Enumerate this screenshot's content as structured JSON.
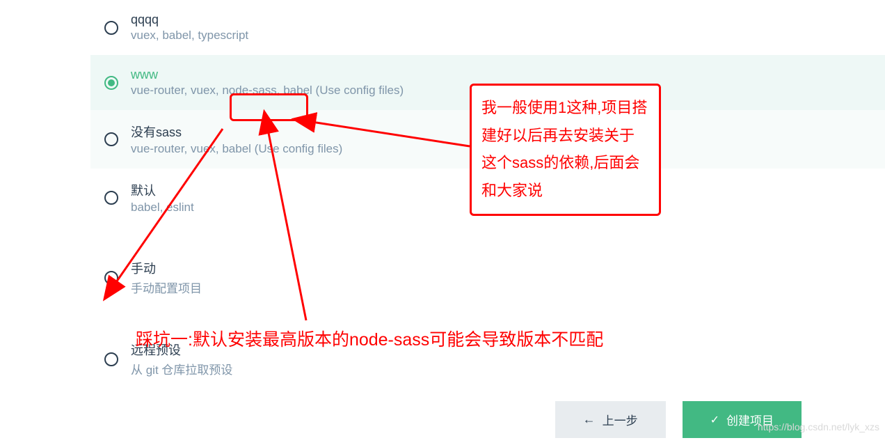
{
  "options": [
    {
      "title": "qqqq",
      "desc": "vuex, babel, typescript",
      "selected": false
    },
    {
      "title": "www",
      "desc": "vue-router, vuex, node-sass, babel (Use config files)",
      "selected": true
    },
    {
      "title": "没有sass",
      "desc": "vue-router, vuex, babel (Use config files)",
      "selected": false
    },
    {
      "title": "默认",
      "desc": "babel, eslint",
      "selected": false
    },
    {
      "title": "手动",
      "desc": "手动配置项目",
      "selected": false
    },
    {
      "title": "远程预设",
      "desc": "从 git 仓库拉取预设",
      "selected": false
    }
  ],
  "buttons": {
    "prev": "上一步",
    "create": "创建项目"
  },
  "annotations": {
    "comment": "我一般使用1这种,项目搭建好以后再去安装关于这个sass的依赖,后面会和大家说",
    "bottom": "踩坑一:默认安装最高版本的node-sass可能会导致版本不匹配"
  },
  "watermark": "https://blog.csdn.net/lyk_xzs"
}
